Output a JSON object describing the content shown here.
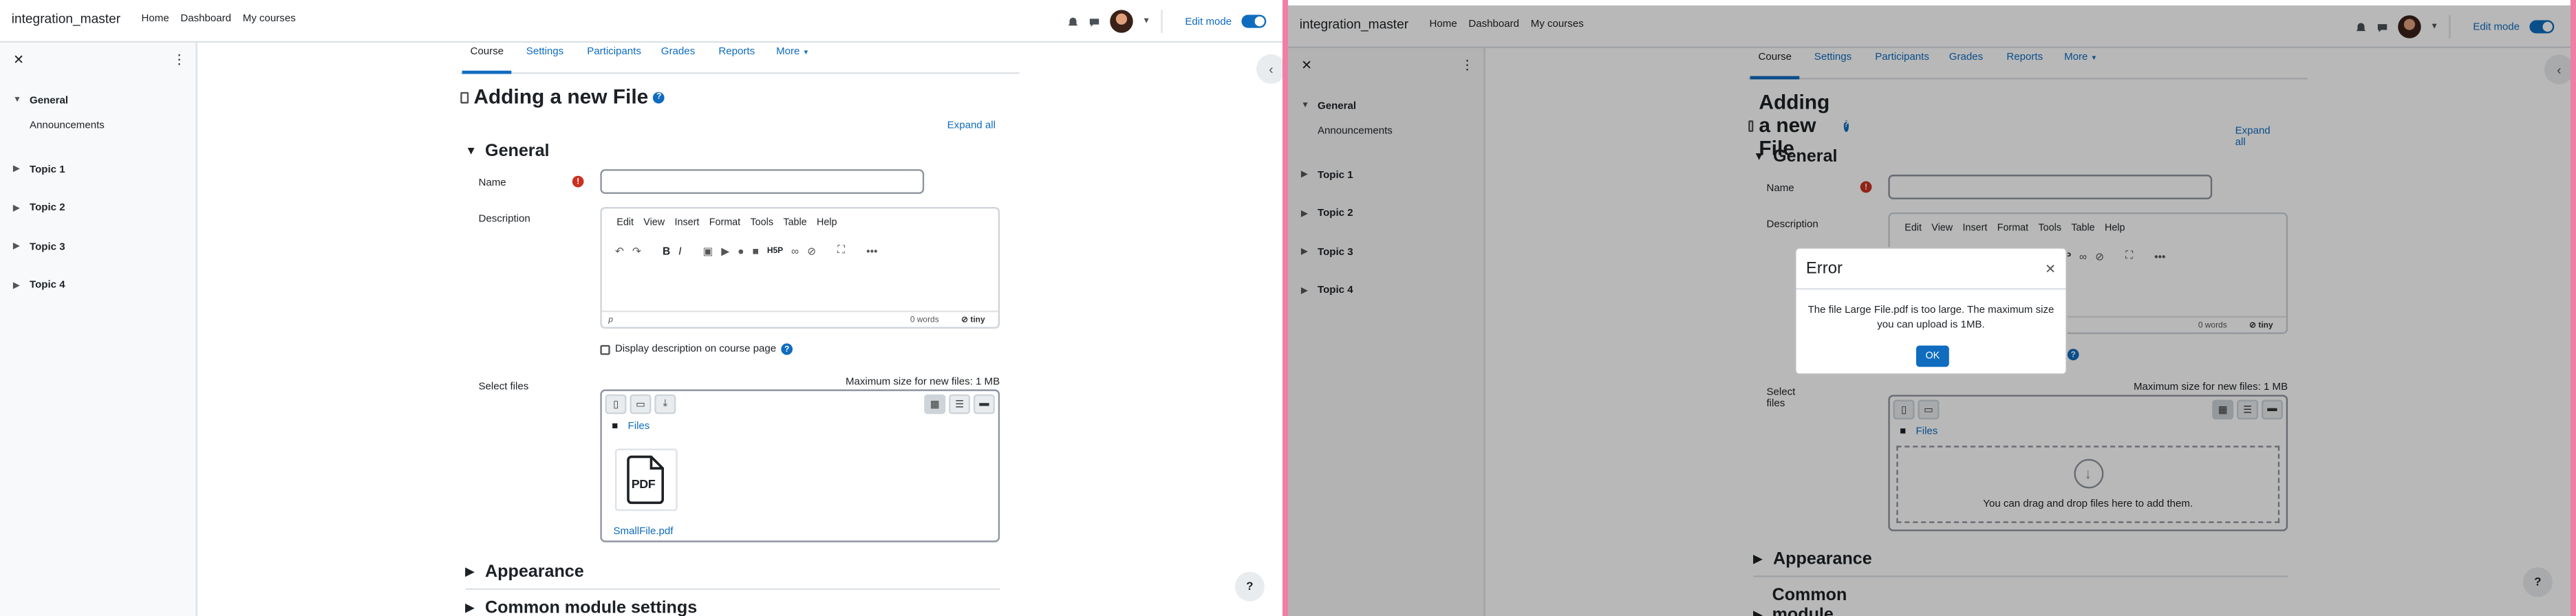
{
  "left": {
    "site_name": "integration_master",
    "nav": [
      "Home",
      "Dashboard",
      "My courses"
    ],
    "edit_mode": "Edit mode",
    "drawer": {
      "sections": [
        {
          "label": "General",
          "items": [
            "Announcements"
          ]
        },
        {
          "label": "Topic 1"
        },
        {
          "label": "Topic 2"
        },
        {
          "label": "Topic 3"
        },
        {
          "label": "Topic 4"
        }
      ]
    },
    "tabs": [
      "Course",
      "Settings",
      "Participants",
      "Grades",
      "Reports",
      "More"
    ],
    "page_title": "Adding a new File",
    "expand_all": "Expand all",
    "general": "General",
    "name_label": "Name",
    "description_label": "Description",
    "editor_menu": [
      "Edit",
      "View",
      "Insert",
      "Format",
      "Tools",
      "Table",
      "Help"
    ],
    "editor_status_p": "p",
    "editor_words": "0 words",
    "tiny": "tiny",
    "display_desc": "Display description on course page",
    "select_files": "Select files",
    "max_size": "Maximum size for new files: 1 MB",
    "files_path": "Files",
    "file_name": "SmallFile.pdf",
    "pdf_label": "PDF",
    "appearance": "Appearance",
    "common_settings": "Common module settings"
  },
  "right": {
    "site_name": "integration_master",
    "nav": [
      "Home",
      "Dashboard",
      "My courses"
    ],
    "edit_mode": "Edit mode",
    "drawer": {
      "sections": [
        {
          "label": "General",
          "items": [
            "Announcements"
          ]
        },
        {
          "label": "Topic 1"
        },
        {
          "label": "Topic 2"
        },
        {
          "label": "Topic 3"
        },
        {
          "label": "Topic 4"
        }
      ]
    },
    "tabs": [
      "Course",
      "Settings",
      "Participants",
      "Grades",
      "Reports",
      "More"
    ],
    "page_title": "Adding a new File",
    "expand_all": "Expand all",
    "general": "General",
    "name_label": "Name",
    "description_label": "Description",
    "editor_menu": [
      "Edit",
      "View",
      "Insert",
      "Format",
      "Tools",
      "Table",
      "Help"
    ],
    "editor_words": "0 words",
    "tiny": "tiny",
    "select_files": "Select files",
    "max_size": "Maximum size for new files: 1 MB",
    "files_path": "Files",
    "dnd_text": "You can drag and drop files here to add them.",
    "appearance": "Appearance",
    "common_settings": "Common module settings",
    "modal": {
      "title": "Error",
      "body": "The file Large File.pdf is too large. The maximum size you can upload is 1MB.",
      "ok": "OK"
    }
  },
  "colors": {
    "accent": "#0f6cbf",
    "danger": "#ca3120",
    "divider": "#f07fa6"
  }
}
